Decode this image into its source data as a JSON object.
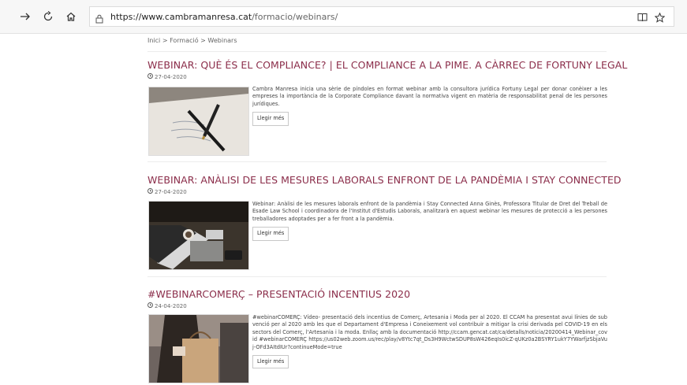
{
  "browser": {
    "url_host": "https://www.cambramanresa.cat",
    "url_path": "/formacio/webinars/",
    "back_icon": "back-arrow-icon",
    "forward_icon": "forward-arrow-icon",
    "refresh_icon": "refresh-icon",
    "home_icon": "home-icon"
  },
  "breadcrumb": "Inici > Formació > Webinars",
  "posts": [
    {
      "title": "WEBINAR: QUÈ ÉS EL COMPLIANCE? | EL COMPLIANCE A LA PIME. A CÀRREC DE FORTUNY LEGAL",
      "date": "27-04-2020",
      "excerpt": "Cambra Manresa inicia una sèrie de píndoles en format webinar amb la consultora jurídica Fortuny Legal per donar conèixer a les empreses la importància de la Corporate Compliance davant la normativa vigent en matèria de responsabilitat penal de les persones jurídiques.",
      "more": "Llegir més"
    },
    {
      "title": "WEBINAR: ANÀLISI DE LES MESURES LABORALS ENFRONT DE LA PANDÈMIA I STAY CONNECTED",
      "date": "27-04-2020",
      "excerpt": " Webinar: Anàlisi de les mesures laborals enfront de la pandèmia i Stay Connected Anna Ginès, Professora Titular de Dret del Treball de Esade Law School i coordinadora de l'Institut d'Estudis Laborals, analitzarà en aquest webinar les mesures de protecció a les persones treballadores adoptades per a fer front a la pandèmia.",
      "more": "Llegir més"
    },
    {
      "title": "#WEBINARCOMERÇ – PRESENTACIÓ INCENTIUS 2020",
      "date": "24-04-2020",
      "excerpt": "#webinarCOMERÇ: Vídeo- presentació dels incentius de Comerç, Artesania i Moda per al 2020.   El CCAM ha presentat avui línies de subvenció per al 2020 amb les que el Departament d'Empresa i Coneixement vol contribuir a mitigar la crisi derivada pel COVID-19 en els sectors del Comerç, l'Artesania i la moda. Enllaç amb la documentació http://ccam.gencat.cat/ca/detalls/noticia/20200414_Webinar_covid #webinarCOMERÇ https://us02web.zoom.us/rec/play/v8Ytc7qt_Ds3H9WctwSDUP8sW426eqIs0icZ-qUKz0a2BSYRY1ukY7YWarfjzSbjaVuj-OFd3AItdIUr?continueMode=true",
      "more": "Llegir més"
    }
  ]
}
